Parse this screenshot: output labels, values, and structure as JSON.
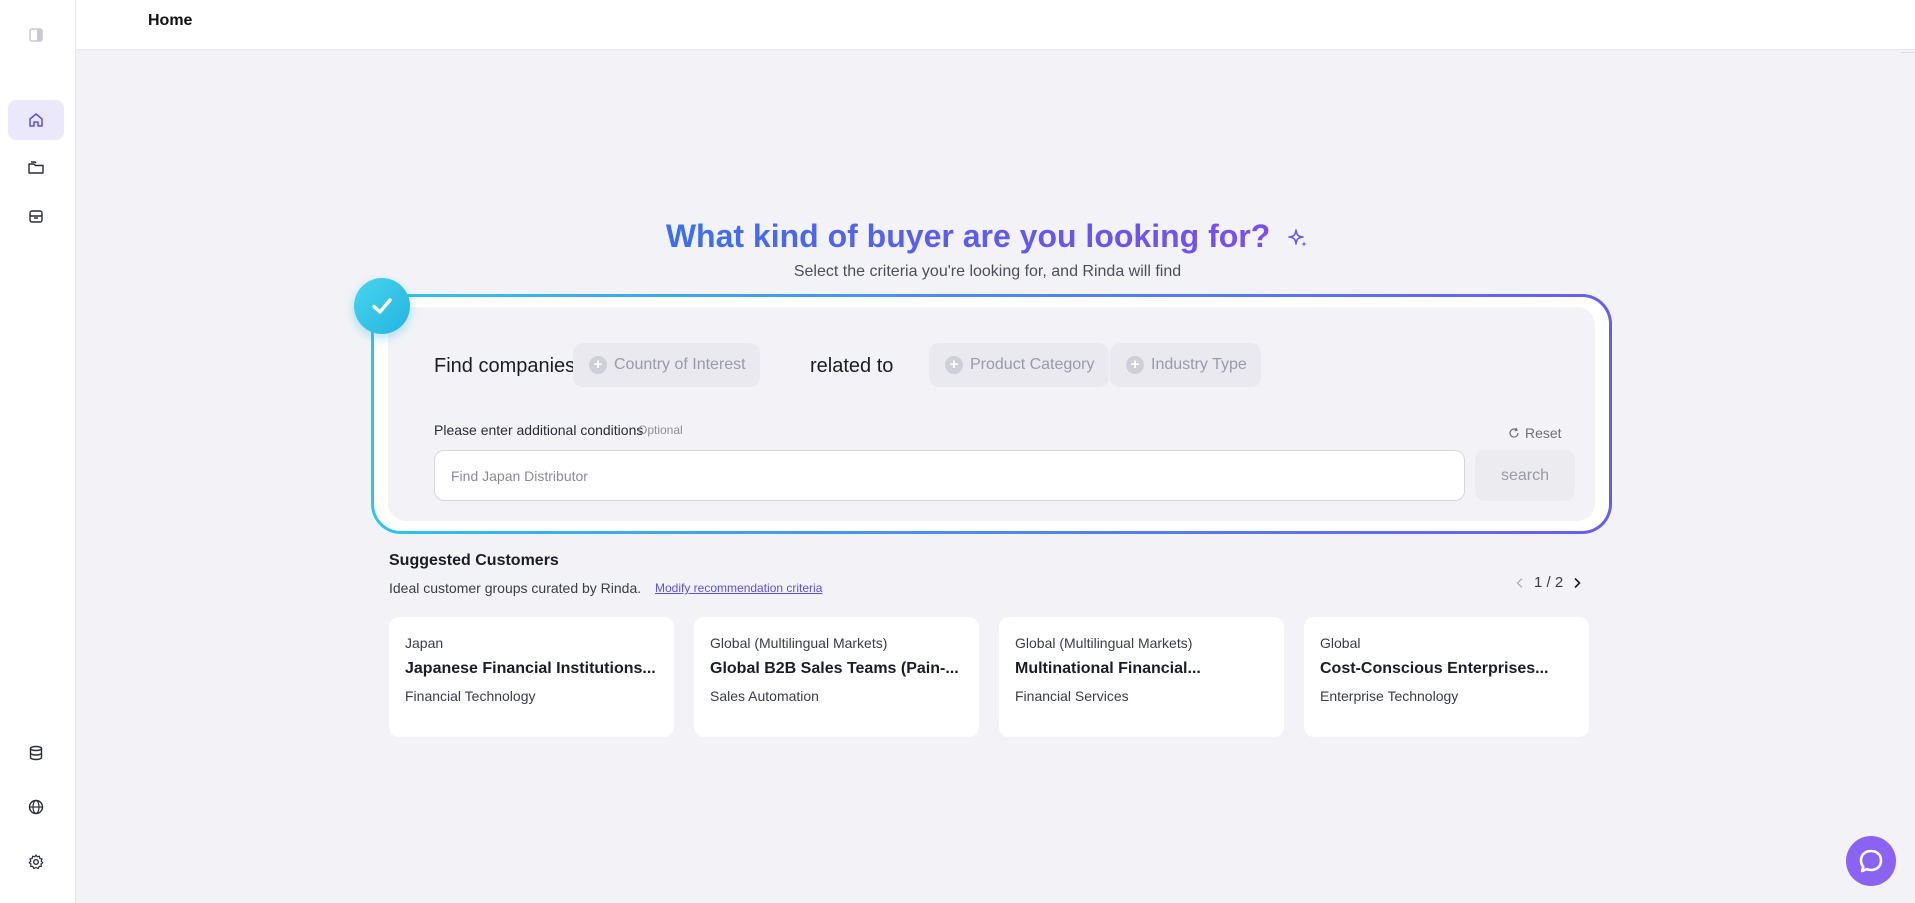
{
  "header": {
    "title": "Home"
  },
  "hero": {
    "title": "What kind of buyer are you looking for?",
    "subtitle": "Select the criteria you're looking for, and Rinda will find"
  },
  "search": {
    "find_label": "Find companies in",
    "country_chip": "Country of Interest",
    "related_label": "related to",
    "product_chip": "Product Category",
    "industry_chip": "Industry Type",
    "conditions_label": "Please enter additional conditions",
    "optional_label": "Optional",
    "reset_label": "Reset",
    "input_placeholder": "Find Japan Distributor",
    "search_button": "search"
  },
  "suggested": {
    "title": "Suggested Customers",
    "subtitle": "Ideal customer groups curated by Rinda.",
    "modify_link": "Modify recommendation criteria",
    "pager": "1 / 2",
    "cards": [
      {
        "location": "Japan",
        "name": "Japanese Financial Institutions...",
        "industry": "Financial Technology"
      },
      {
        "location": "Global (Multilingual Markets)",
        "name": "Global B2B Sales Teams (Pain-...",
        "industry": "Sales Automation"
      },
      {
        "location": "Global (Multilingual Markets)",
        "name": "Multinational Financial...",
        "industry": "Financial Services"
      },
      {
        "location": "Global",
        "name": "Cost-Conscious Enterprises...",
        "industry": "Enterprise Technology"
      }
    ]
  },
  "icons": {
    "sidebar_toggle": "sidebar-toggle-icon",
    "home": "home-icon",
    "folders": "folders-icon",
    "archive": "archive-box-icon",
    "database": "database-icon",
    "globe": "globe-icon",
    "settings": "gear-icon",
    "chat": "chat-icon"
  },
  "colors": {
    "accent": "#6a55f0",
    "title_gradient_start": "#3b6ff0",
    "frame_gradient_start": "#2ec5ea",
    "check": "#23b3e0",
    "chat": "#8a63f2"
  }
}
